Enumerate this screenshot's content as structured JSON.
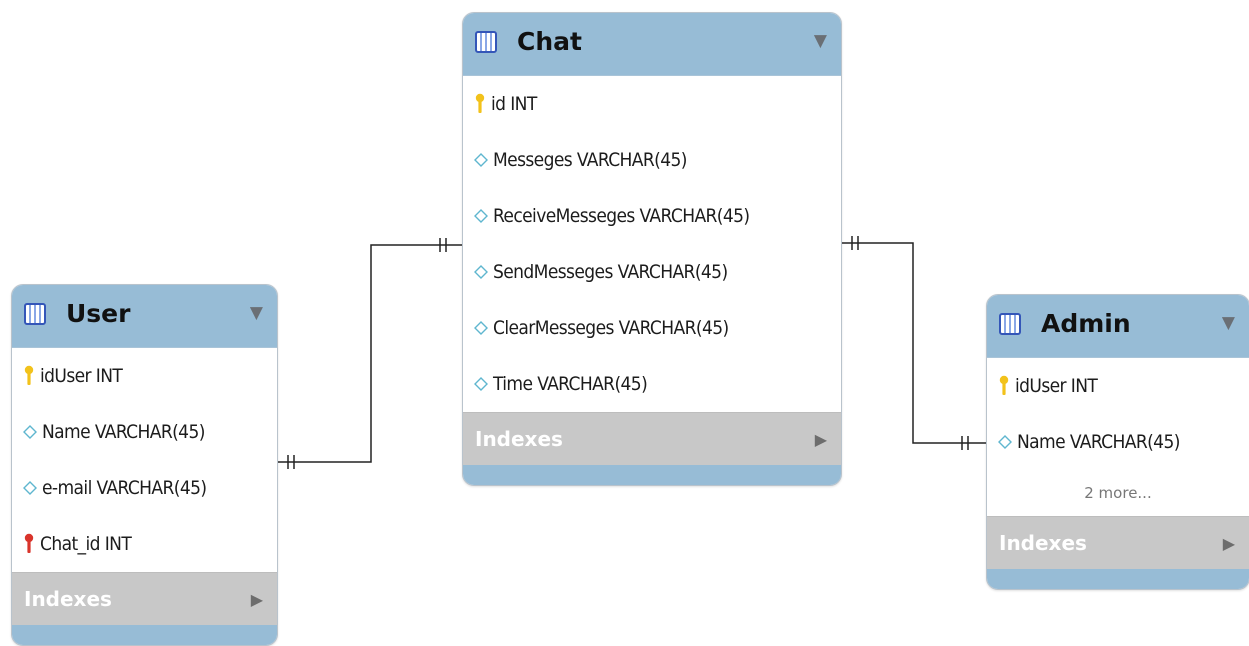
{
  "tables": {
    "chat": {
      "title": "Chat",
      "columns": [
        {
          "text": "id INT",
          "icon": "primary-key-icon"
        },
        {
          "text": "Messeges VARCHAR(45)",
          "icon": "column-diamond-icon"
        },
        {
          "text": "ReceiveMesseges VARCHAR(45)",
          "icon": "column-diamond-icon"
        },
        {
          "text": "SendMesseges VARCHAR(45)",
          "icon": "column-diamond-icon"
        },
        {
          "text": "ClearMesseges VARCHAR(45)",
          "icon": "column-diamond-icon"
        },
        {
          "text": "Time VARCHAR(45)",
          "icon": "column-diamond-icon"
        }
      ],
      "indexes_label": "Indexes"
    },
    "user": {
      "title": "User",
      "columns": [
        {
          "text": "idUser INT",
          "icon": "primary-key-icon"
        },
        {
          "text": "Name VARCHAR(45)",
          "icon": "column-diamond-icon"
        },
        {
          "text": "e-mail VARCHAR(45)",
          "icon": "column-diamond-icon"
        },
        {
          "text": "Chat_id INT",
          "icon": "foreign-key-icon"
        }
      ],
      "indexes_label": "Indexes"
    },
    "admin": {
      "title": "Admin",
      "columns": [
        {
          "text": "idUser INT",
          "icon": "primary-key-icon"
        },
        {
          "text": "Name VARCHAR(45)",
          "icon": "column-diamond-icon"
        }
      ],
      "more_label": "2 more...",
      "indexes_label": "Indexes"
    }
  },
  "colors": {
    "header": "#97bcd6",
    "indexes_bar": "#c8c8c8",
    "primary_key": "#f2c21b",
    "foreign_key": "#d9342b",
    "column_diamond": "#5fb6cf",
    "table_icon": "#3456b8",
    "connector": "#222222"
  },
  "relationships": [
    {
      "from": "user",
      "to": "chat",
      "notation": "one-and-only-one"
    },
    {
      "from": "chat",
      "to": "admin",
      "notation": "one-and-only-one"
    }
  ]
}
